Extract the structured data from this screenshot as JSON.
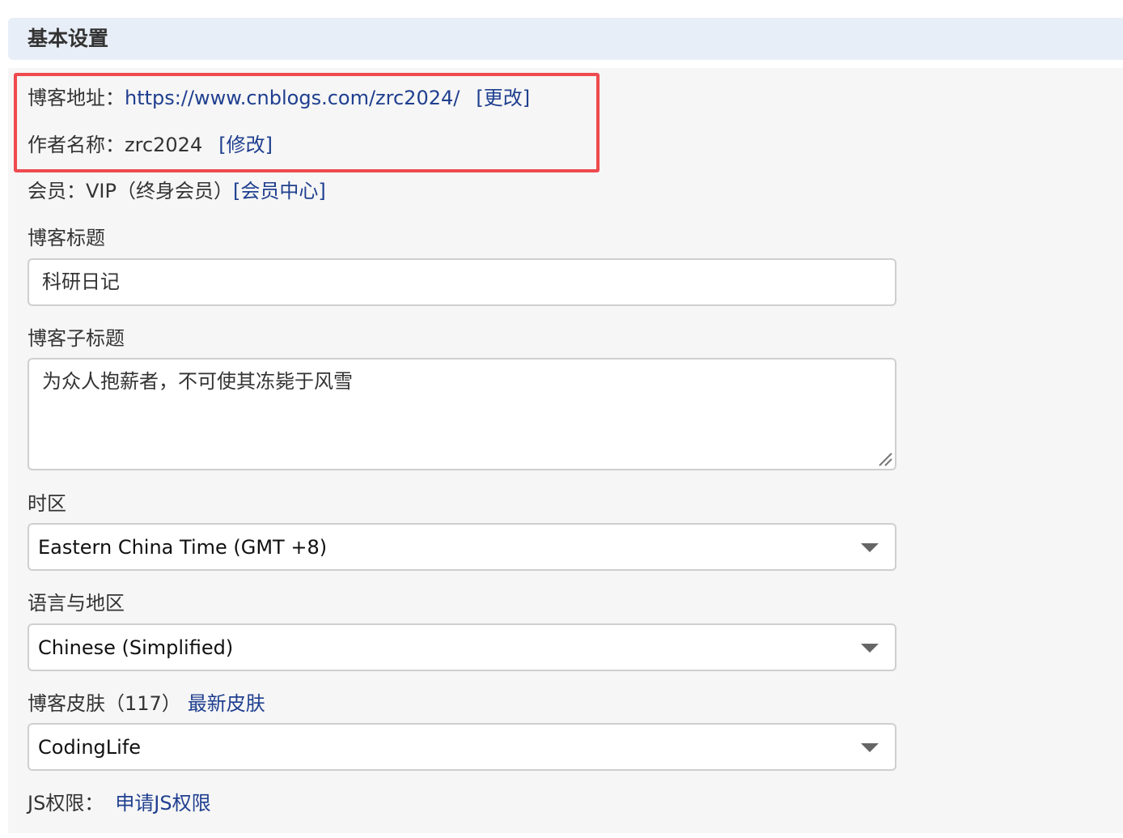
{
  "section": {
    "title": "基本设置"
  },
  "blog_address": {
    "label": "博客地址：",
    "url": "https://www.cnblogs.com/zrc2024/",
    "change_link": "[更改]"
  },
  "author": {
    "label": "作者名称：",
    "name": "zrc2024",
    "edit_link": "[修改]"
  },
  "membership": {
    "label": "会员：",
    "value": "VIP（终身会员）",
    "center_link": "[会员中心]"
  },
  "blog_title": {
    "label": "博客标题",
    "value": "科研日记"
  },
  "blog_subtitle": {
    "label": "博客子标题",
    "value": "为众人抱薪者，不可使其冻毙于风雪"
  },
  "timezone": {
    "label": "时区",
    "selected": "Eastern China Time (GMT +8)"
  },
  "language": {
    "label": "语言与地区",
    "selected": "Chinese (Simplified)"
  },
  "skin": {
    "label": "博客皮肤（117）",
    "latest_link": "最新皮肤",
    "selected": "CodingLife"
  },
  "js_permission": {
    "label": "JS权限：",
    "apply_link": "申请JS权限"
  },
  "colors": {
    "link": "#1f3f8f",
    "highlight_border": "#ef4a4f",
    "header_bg": "#e8eef7",
    "panel_bg": "#f6f6f6"
  },
  "icons": {
    "select_arrow": "chevron-down-icon",
    "textarea_resize": "resize-grip-icon"
  }
}
